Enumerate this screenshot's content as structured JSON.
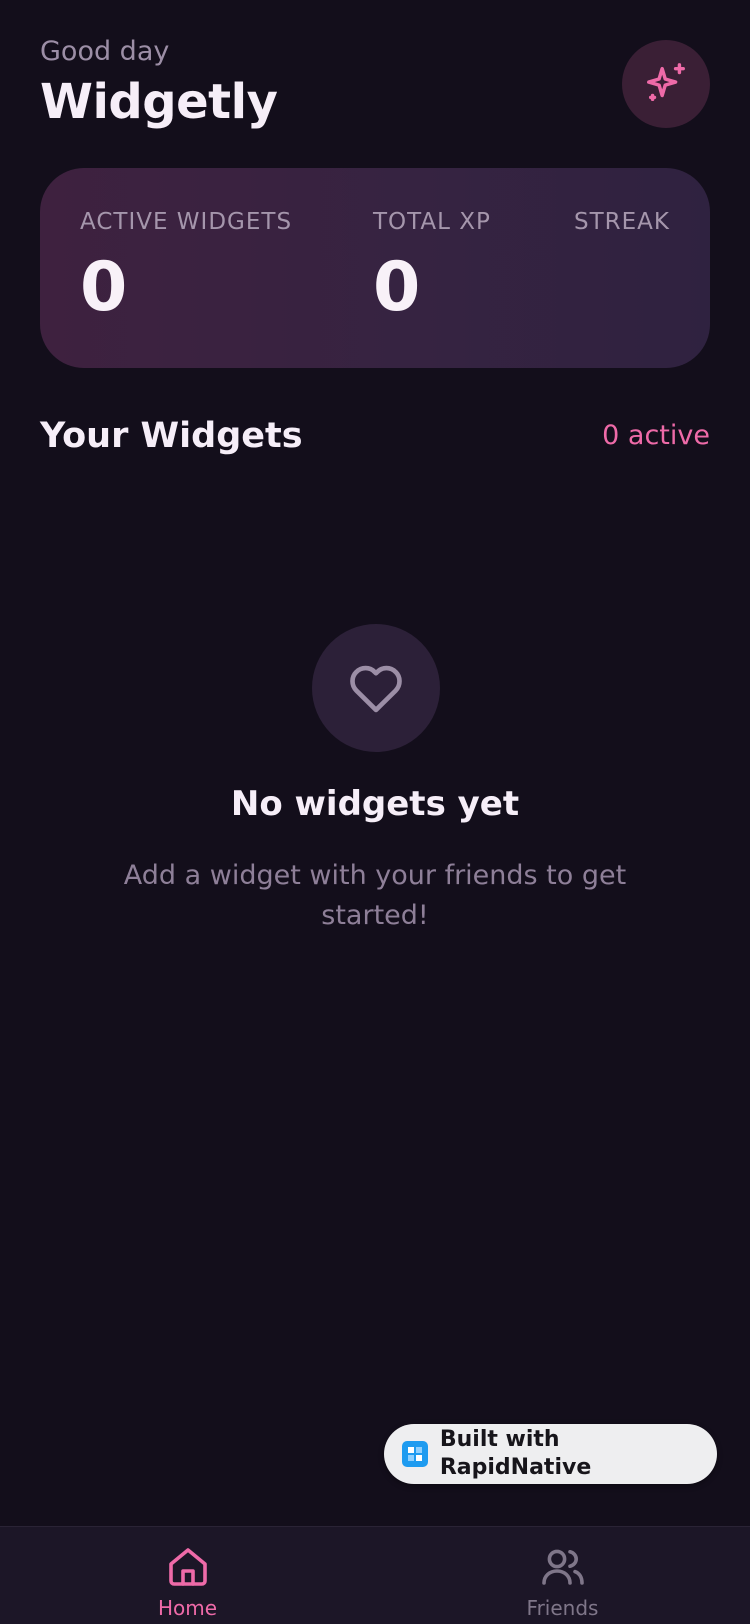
{
  "header": {
    "greeting": "Good day",
    "title": "Widgetly",
    "action_icon": "sparkles-icon"
  },
  "stats": [
    {
      "label": "ACTIVE WIDGETS",
      "value": "0"
    },
    {
      "label": "TOTAL XP",
      "value": "0"
    },
    {
      "label": "STREAK",
      "value": ""
    }
  ],
  "widgets_section": {
    "title": "Your Widgets",
    "active_count": "0 active"
  },
  "empty_state": {
    "icon": "heart-icon",
    "title": "No widgets yet",
    "description": "Add a widget with your friends to get started!"
  },
  "badge": {
    "label": "Built with RapidNative",
    "icon": "rapidnative-logo-icon"
  },
  "tab_bar": {
    "tabs": [
      {
        "label": "Home",
        "icon": "home-icon",
        "active": true
      },
      {
        "label": "Friends",
        "icon": "users-icon",
        "active": false
      }
    ]
  },
  "colors": {
    "background": "#130e1b",
    "accent": "#ee6aa8",
    "card": "#3a2140",
    "tab_bar": "#1c1627"
  }
}
